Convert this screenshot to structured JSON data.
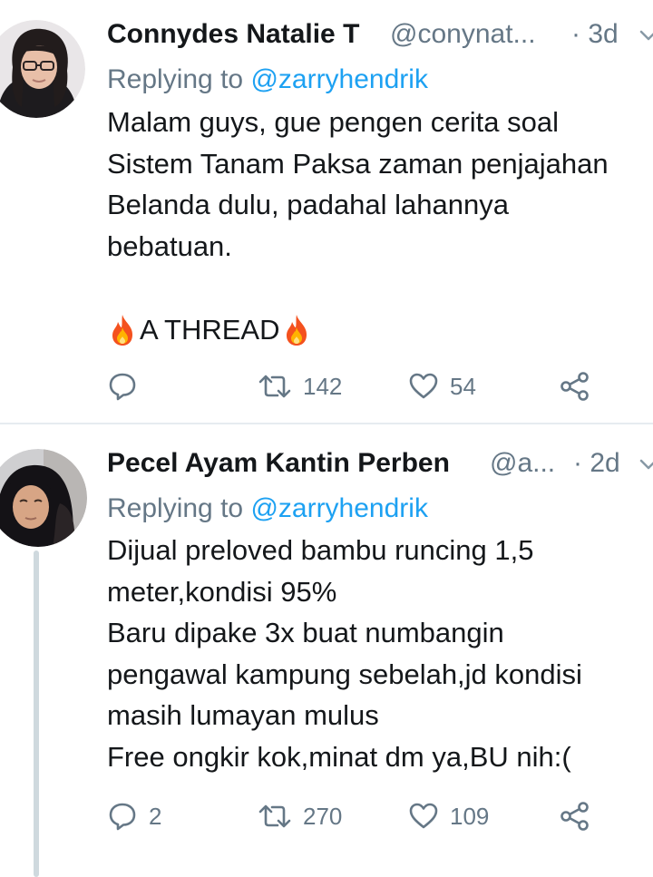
{
  "tweets": [
    {
      "name": "Connydes Natalie T",
      "handle": "@conynat...",
      "time": "· 3d",
      "replying_prefix": "Replying to",
      "replying_to": "@zarryhendrik",
      "body_lines": [
        "Malam guys, gue pengen cerita soal",
        "Sistem Tanam Paksa zaman penjajahan",
        "Belanda dulu, padahal lahannya",
        "bebatuan."
      ],
      "thread_label": "A THREAD",
      "thread_emoji": "fire-emoji",
      "actions": {
        "reply_count": "",
        "retweet_count": "142",
        "like_count": "54"
      }
    },
    {
      "name": "Pecel Ayam Kantin Perben",
      "handle": "@a...",
      "time": "· 2d",
      "replying_prefix": "Replying to",
      "replying_to": "@zarryhendrik",
      "body_lines": [
        "Dijual preloved bambu runcing 1,5",
        "meter,kondisi 95%",
        "Baru dipake 3x buat numbangin",
        "pengawal kampung sebelah,jd kondisi",
        "masih lumayan mulus",
        "Free ongkir kok,minat dm ya,BU nih:("
      ],
      "actions": {
        "reply_count": "2",
        "retweet_count": "270",
        "like_count": "109"
      }
    }
  ],
  "icons": [
    "reply-icon",
    "retweet-icon",
    "like-icon",
    "share-icon",
    "more-caret-icon"
  ],
  "colors": {
    "text": "#14171a",
    "secondary": "#657786",
    "mention": "#1da1f2",
    "divider": "#e6ecf0",
    "thread_line": "#cfd9de"
  }
}
